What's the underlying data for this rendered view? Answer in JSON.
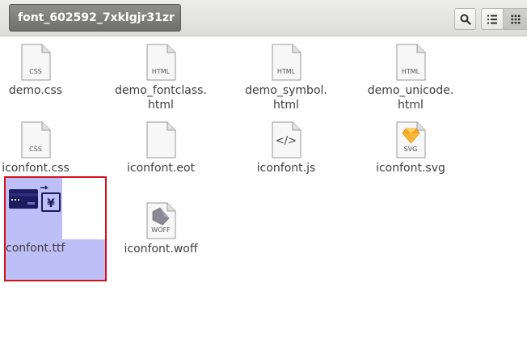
{
  "window": {
    "path_button_label": "font_602592_7xklgjr31zr"
  },
  "toolbar": {
    "search_icon": "search-icon",
    "list_view_icon": "list-view-icon",
    "grid_view_icon": "grid-view-icon"
  },
  "files": [
    {
      "name_line1": "demo.css",
      "name_line2": "",
      "tag": "CSS",
      "icon": "css-file-icon"
    },
    {
      "name_line1": "demo_fontclass.",
      "name_line2": "html",
      "tag": "HTML",
      "icon": "html-file-icon"
    },
    {
      "name_line1": "demo_symbol.",
      "name_line2": "html",
      "tag": "HTML",
      "icon": "html-file-icon"
    },
    {
      "name_line1": "demo_unicode.",
      "name_line2": "html",
      "tag": "HTML",
      "icon": "html-file-icon"
    },
    {
      "name_line1": "iconfont.css",
      "name_line2": "",
      "tag": "CSS",
      "icon": "css-file-icon"
    },
    {
      "name_line1": "iconfont.eot",
      "name_line2": "",
      "tag": "",
      "icon": "blank-file-icon"
    },
    {
      "name_line1": "iconfont.js",
      "name_line2": "",
      "tag": "</>",
      "icon": "js-file-icon"
    },
    {
      "name_line1": "iconfont.svg",
      "name_line2": "",
      "tag": "SVG",
      "icon": "svg-file-icon"
    },
    {
      "name_line1": "confont.ttf",
      "name_line2": "",
      "tag": "",
      "icon": "font-preview-icon"
    },
    {
      "name_line1": "iconfont.woff",
      "name_line2": "",
      "tag": "WOFF",
      "icon": "woff-file-icon"
    }
  ],
  "selected_preview_glyph": "¥",
  "colors": {
    "selection": "#bfbff8",
    "highlight_border": "#d4101b"
  }
}
